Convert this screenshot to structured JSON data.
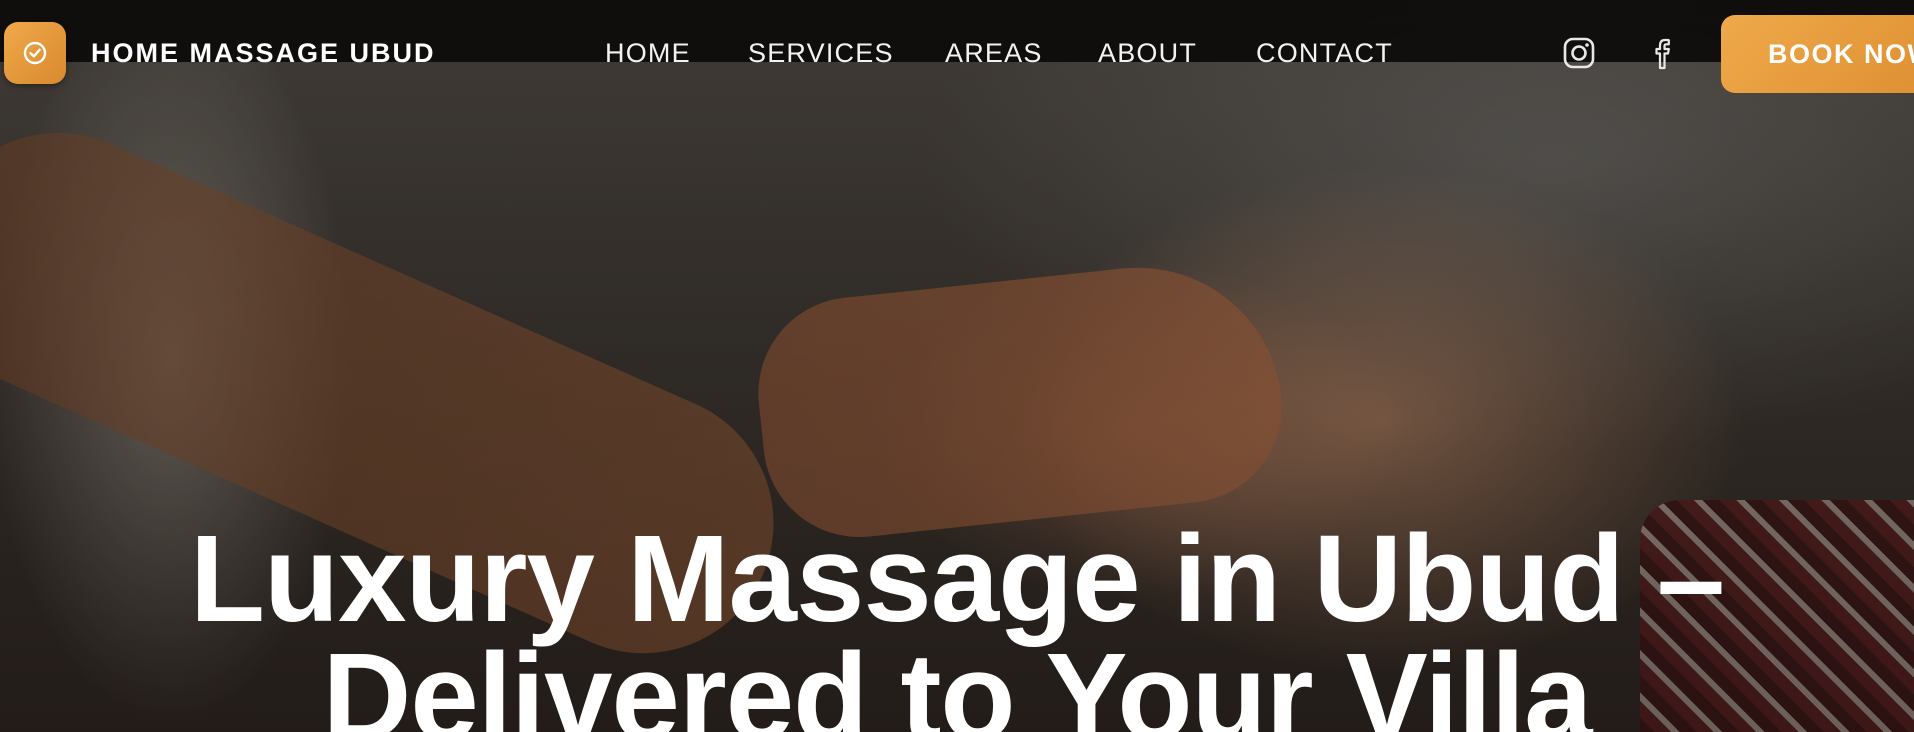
{
  "brand": {
    "name": "HOME MASSAGE UBUD",
    "logo_icon": "check-circle-icon",
    "accent_color": "#e89c3c"
  },
  "nav": {
    "items": [
      {
        "label": "HOME"
      },
      {
        "label": "SERVICES"
      },
      {
        "label": "AREAS"
      },
      {
        "label": "ABOUT"
      },
      {
        "label": "CONTACT"
      }
    ]
  },
  "social": {
    "instagram_icon": "instagram-icon",
    "facebook_icon": "facebook-icon"
  },
  "cta": {
    "book_label": "BOOK NOW"
  },
  "hero": {
    "title_line1": "Luxury Massage in Ubud –",
    "title_line2": "Delivered to Your Villa"
  }
}
